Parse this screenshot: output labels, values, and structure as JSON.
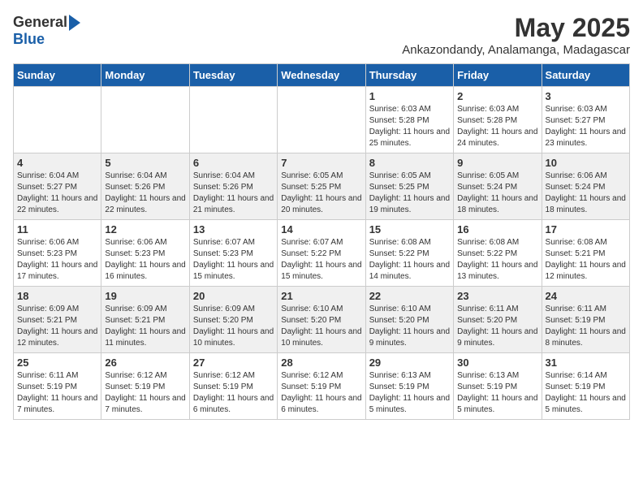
{
  "logo": {
    "general": "General",
    "blue": "Blue"
  },
  "title": "May 2025",
  "location": "Ankazondandy, Analamanga, Madagascar",
  "days_of_week": [
    "Sunday",
    "Monday",
    "Tuesday",
    "Wednesday",
    "Thursday",
    "Friday",
    "Saturday"
  ],
  "weeks": [
    [
      {
        "day": "",
        "info": ""
      },
      {
        "day": "",
        "info": ""
      },
      {
        "day": "",
        "info": ""
      },
      {
        "day": "",
        "info": ""
      },
      {
        "day": "1",
        "info": "Sunrise: 6:03 AM\nSunset: 5:28 PM\nDaylight: 11 hours and 25 minutes."
      },
      {
        "day": "2",
        "info": "Sunrise: 6:03 AM\nSunset: 5:28 PM\nDaylight: 11 hours and 24 minutes."
      },
      {
        "day": "3",
        "info": "Sunrise: 6:03 AM\nSunset: 5:27 PM\nDaylight: 11 hours and 23 minutes."
      }
    ],
    [
      {
        "day": "4",
        "info": "Sunrise: 6:04 AM\nSunset: 5:27 PM\nDaylight: 11 hours and 22 minutes."
      },
      {
        "day": "5",
        "info": "Sunrise: 6:04 AM\nSunset: 5:26 PM\nDaylight: 11 hours and 22 minutes."
      },
      {
        "day": "6",
        "info": "Sunrise: 6:04 AM\nSunset: 5:26 PM\nDaylight: 11 hours and 21 minutes."
      },
      {
        "day": "7",
        "info": "Sunrise: 6:05 AM\nSunset: 5:25 PM\nDaylight: 11 hours and 20 minutes."
      },
      {
        "day": "8",
        "info": "Sunrise: 6:05 AM\nSunset: 5:25 PM\nDaylight: 11 hours and 19 minutes."
      },
      {
        "day": "9",
        "info": "Sunrise: 6:05 AM\nSunset: 5:24 PM\nDaylight: 11 hours and 18 minutes."
      },
      {
        "day": "10",
        "info": "Sunrise: 6:06 AM\nSunset: 5:24 PM\nDaylight: 11 hours and 18 minutes."
      }
    ],
    [
      {
        "day": "11",
        "info": "Sunrise: 6:06 AM\nSunset: 5:23 PM\nDaylight: 11 hours and 17 minutes."
      },
      {
        "day": "12",
        "info": "Sunrise: 6:06 AM\nSunset: 5:23 PM\nDaylight: 11 hours and 16 minutes."
      },
      {
        "day": "13",
        "info": "Sunrise: 6:07 AM\nSunset: 5:23 PM\nDaylight: 11 hours and 15 minutes."
      },
      {
        "day": "14",
        "info": "Sunrise: 6:07 AM\nSunset: 5:22 PM\nDaylight: 11 hours and 15 minutes."
      },
      {
        "day": "15",
        "info": "Sunrise: 6:08 AM\nSunset: 5:22 PM\nDaylight: 11 hours and 14 minutes."
      },
      {
        "day": "16",
        "info": "Sunrise: 6:08 AM\nSunset: 5:22 PM\nDaylight: 11 hours and 13 minutes."
      },
      {
        "day": "17",
        "info": "Sunrise: 6:08 AM\nSunset: 5:21 PM\nDaylight: 11 hours and 12 minutes."
      }
    ],
    [
      {
        "day": "18",
        "info": "Sunrise: 6:09 AM\nSunset: 5:21 PM\nDaylight: 11 hours and 12 minutes."
      },
      {
        "day": "19",
        "info": "Sunrise: 6:09 AM\nSunset: 5:21 PM\nDaylight: 11 hours and 11 minutes."
      },
      {
        "day": "20",
        "info": "Sunrise: 6:09 AM\nSunset: 5:20 PM\nDaylight: 11 hours and 10 minutes."
      },
      {
        "day": "21",
        "info": "Sunrise: 6:10 AM\nSunset: 5:20 PM\nDaylight: 11 hours and 10 minutes."
      },
      {
        "day": "22",
        "info": "Sunrise: 6:10 AM\nSunset: 5:20 PM\nDaylight: 11 hours and 9 minutes."
      },
      {
        "day": "23",
        "info": "Sunrise: 6:11 AM\nSunset: 5:20 PM\nDaylight: 11 hours and 9 minutes."
      },
      {
        "day": "24",
        "info": "Sunrise: 6:11 AM\nSunset: 5:19 PM\nDaylight: 11 hours and 8 minutes."
      }
    ],
    [
      {
        "day": "25",
        "info": "Sunrise: 6:11 AM\nSunset: 5:19 PM\nDaylight: 11 hours and 7 minutes."
      },
      {
        "day": "26",
        "info": "Sunrise: 6:12 AM\nSunset: 5:19 PM\nDaylight: 11 hours and 7 minutes."
      },
      {
        "day": "27",
        "info": "Sunrise: 6:12 AM\nSunset: 5:19 PM\nDaylight: 11 hours and 6 minutes."
      },
      {
        "day": "28",
        "info": "Sunrise: 6:12 AM\nSunset: 5:19 PM\nDaylight: 11 hours and 6 minutes."
      },
      {
        "day": "29",
        "info": "Sunrise: 6:13 AM\nSunset: 5:19 PM\nDaylight: 11 hours and 5 minutes."
      },
      {
        "day": "30",
        "info": "Sunrise: 6:13 AM\nSunset: 5:19 PM\nDaylight: 11 hours and 5 minutes."
      },
      {
        "day": "31",
        "info": "Sunrise: 6:14 AM\nSunset: 5:19 PM\nDaylight: 11 hours and 5 minutes."
      }
    ]
  ]
}
